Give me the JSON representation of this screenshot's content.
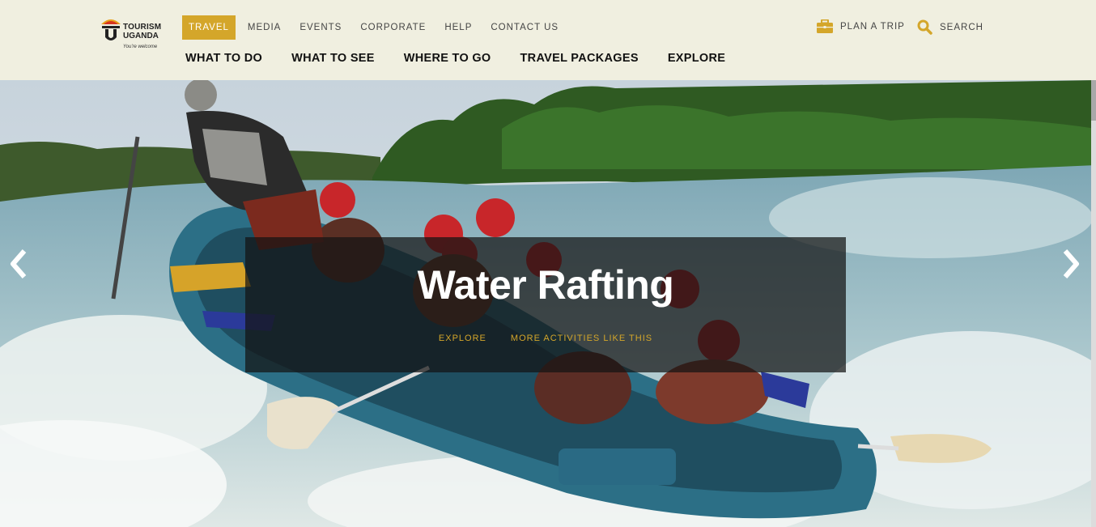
{
  "header": {
    "logo": {
      "line1": "TOURISM",
      "line2": "UGANDA",
      "tagline": "You're welcome"
    },
    "top_nav": [
      {
        "label": "TRAVEL",
        "active": true
      },
      {
        "label": "MEDIA",
        "active": false
      },
      {
        "label": "EVENTS",
        "active": false
      },
      {
        "label": "CORPORATE",
        "active": false
      },
      {
        "label": "HELP",
        "active": false
      },
      {
        "label": "CONTACT US",
        "active": false
      }
    ],
    "main_nav": [
      {
        "label": "WHAT TO DO"
      },
      {
        "label": "WHAT TO SEE"
      },
      {
        "label": "WHERE TO GO"
      },
      {
        "label": "TRAVEL PACKAGES"
      },
      {
        "label": "EXPLORE"
      }
    ],
    "plan_trip": {
      "label": "PLAN A TRIP",
      "icon": "briefcase-icon"
    },
    "search": {
      "label": "SEARCH",
      "icon": "search-icon"
    }
  },
  "hero": {
    "title": "Water Rafting",
    "links": [
      "EXPLORE",
      "MORE ACTIVITIES LIKE THIS"
    ],
    "prev_icon": "chevron-left-icon",
    "next_icon": "chevron-right-icon"
  },
  "colors": {
    "accent": "#d4a62a",
    "header_bg": "#f0efe0",
    "caption_bg": "rgba(20,20,20,0.72)"
  }
}
